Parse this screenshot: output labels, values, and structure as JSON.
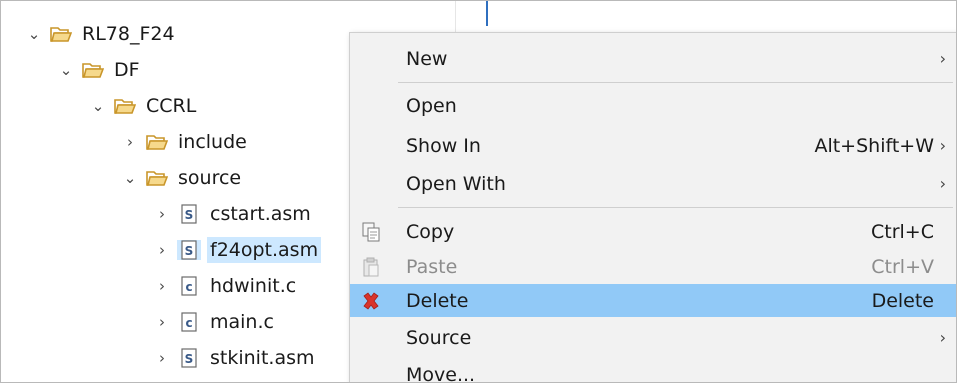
{
  "tree": {
    "items": [
      {
        "label": "RL78_F24",
        "twisty": "expanded",
        "icon": "folder-open-icon"
      },
      {
        "label": "DF",
        "twisty": "expanded",
        "icon": "folder-open-icon"
      },
      {
        "label": "CCRL",
        "twisty": "expanded",
        "icon": "folder-open-icon"
      },
      {
        "label": "include",
        "twisty": "collapsed",
        "icon": "folder-open-icon"
      },
      {
        "label": "source",
        "twisty": "expanded",
        "icon": "folder-open-icon"
      },
      {
        "label": "cstart.asm",
        "twisty": "collapsed",
        "icon": "asm-file-icon"
      },
      {
        "label": "f24opt.asm",
        "twisty": "collapsed",
        "icon": "asm-file-icon",
        "selected": true
      },
      {
        "label": "hdwinit.c",
        "twisty": "collapsed",
        "icon": "c-file-icon"
      },
      {
        "label": "main.c",
        "twisty": "collapsed",
        "icon": "c-file-icon"
      },
      {
        "label": "stkinit.asm",
        "twisty": "collapsed",
        "icon": "asm-file-icon"
      }
    ]
  },
  "menu": {
    "items": [
      {
        "label": "New",
        "accel": "",
        "submenu": true
      },
      {
        "label": "Open",
        "accel": "",
        "submenu": false
      },
      {
        "label": "Show In",
        "accel": "Alt+Shift+W",
        "submenu": true
      },
      {
        "label": "Open With",
        "accel": "",
        "submenu": true
      },
      {
        "label": "Copy",
        "accel": "Ctrl+C",
        "submenu": false,
        "icon": "copy-icon"
      },
      {
        "label": "Paste",
        "accel": "Ctrl+V",
        "submenu": false,
        "icon": "paste-icon",
        "disabled": true
      },
      {
        "label": "Delete",
        "accel": "Delete",
        "submenu": false,
        "icon": "delete-icon",
        "highlighted": true
      },
      {
        "label": "Source",
        "accel": "",
        "submenu": true
      },
      {
        "label": "Move...",
        "accel": "",
        "submenu": false
      }
    ]
  },
  "colors": {
    "highlight": "#91c9f7",
    "selection": "#cde8ff",
    "folder": "#e8b84a",
    "delete_icon": "#d9342b"
  },
  "glyphs": {
    "expanded": "⌄",
    "collapsed": "›",
    "submenu_arrow": "›"
  }
}
